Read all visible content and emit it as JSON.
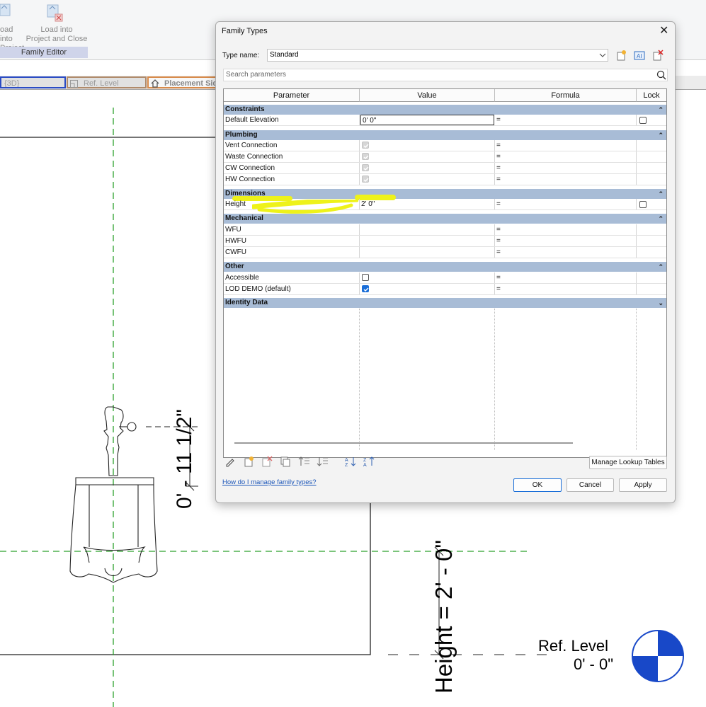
{
  "ribbon": {
    "load_into_project": "Load into Project",
    "load_into_project_visible": [
      "oad into",
      "Project"
    ],
    "load_and_close": [
      "Load into",
      "Project and Close"
    ],
    "panel": "Family Editor"
  },
  "view_tabs": [
    "{3D}",
    "Ref. Level",
    "Placement Side"
  ],
  "view_tabs_visible": [
    "{3D}",
    "Ref. Level",
    "Placement Sid"
  ],
  "drawing": {
    "dim_vertical": "0' - 11 1/2\"",
    "dim_height": "Height = 2' - 0\"",
    "level_name": "Ref. Level",
    "level_value": "0' - 0\""
  },
  "dialog": {
    "title": "Family Types",
    "type_name_label": "Type name:",
    "type_name_value": "Standard",
    "search_placeholder": "Search parameters",
    "columns": [
      "Parameter",
      "Value",
      "Formula",
      "Lock"
    ],
    "groups": [
      {
        "name": "Constraints",
        "rows": [
          {
            "param": "Default Elevation",
            "value": "0'  0\"",
            "formula": "="
          }
        ]
      },
      {
        "name": "Plumbing",
        "rows": [
          {
            "param": "Vent Connection",
            "formula": "="
          },
          {
            "param": "Waste Connection",
            "formula": "="
          },
          {
            "param": "CW Connection",
            "formula": "="
          },
          {
            "param": "HW Connection",
            "formula": "="
          }
        ]
      },
      {
        "name": "Dimensions",
        "rows": [
          {
            "param": "Height",
            "value": "2'  0\"",
            "formula": "="
          }
        ]
      },
      {
        "name": "Mechanical",
        "rows": [
          {
            "param": "WFU",
            "formula": "="
          },
          {
            "param": "HWFU",
            "formula": "="
          },
          {
            "param": "CWFU",
            "formula": "="
          }
        ]
      },
      {
        "name": "Other",
        "rows": [
          {
            "param": "Accessible",
            "formula": "=",
            "checked": false
          },
          {
            "param": "LOD DEMO (default)",
            "formula": "=",
            "checked": true
          }
        ]
      },
      {
        "name": "Identity Data",
        "rows": []
      }
    ],
    "manage_lookup": "Manage Lookup Tables",
    "help_link": "How do I manage family types?",
    "ok": "OK",
    "cancel": "Cancel",
    "apply": "Apply",
    "close_glyph": "✕"
  },
  "colors": {
    "group_header": "#a8bcd6",
    "highlight": "#eef21a",
    "ref_line": "#2ca02c",
    "accent": "#1a6ed8"
  }
}
